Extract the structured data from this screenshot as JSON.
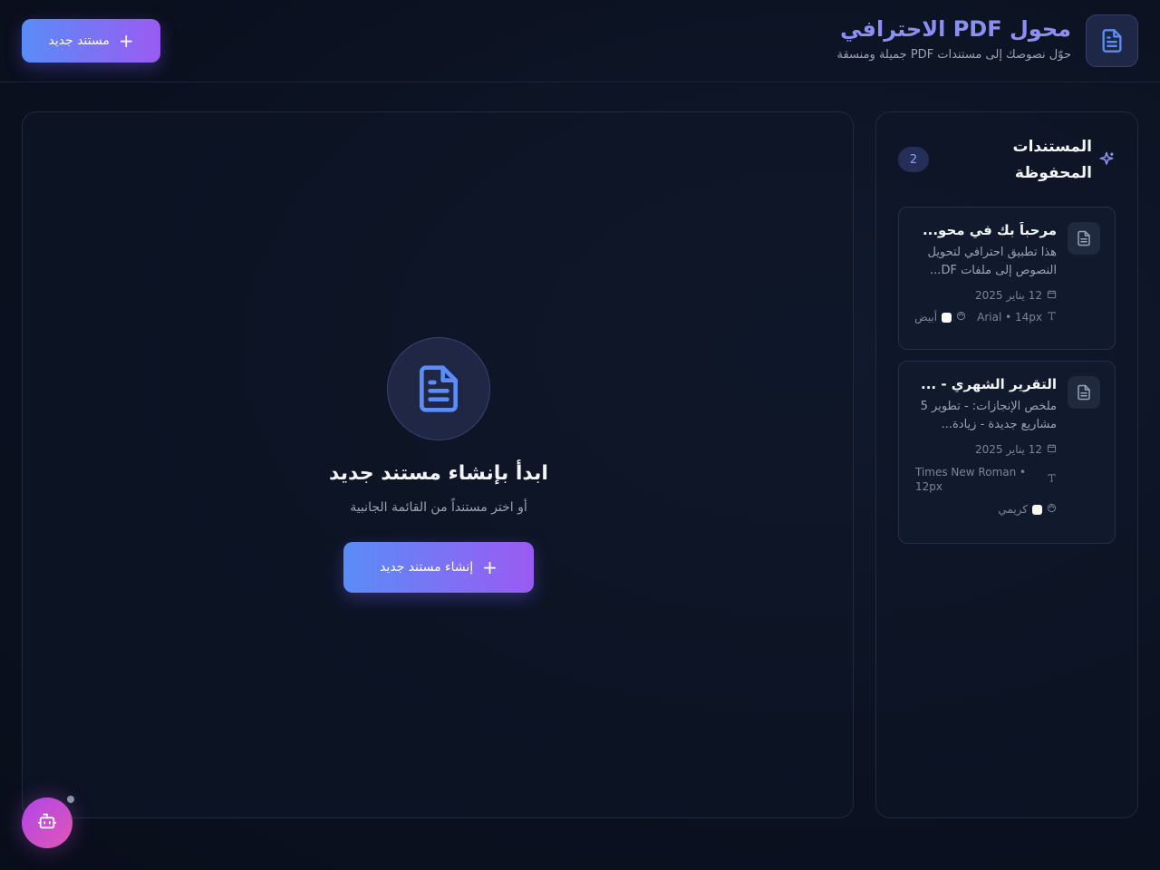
{
  "header": {
    "title": "محول PDF الاحترافي",
    "subtitle": "حوّل نصوصك إلى مستندات PDF جميلة ومنسقة",
    "new_doc_label": "مستند جديد",
    "icon": "file-text-icon"
  },
  "main": {
    "empty_title": "ابدأ بإنشاء مستند جديد",
    "empty_subtitle": "أو اختر مستنداً من القائمة الجانبية",
    "create_label": "إنشاء مستند جديد"
  },
  "sidebar": {
    "title": "المستندات المحفوظة",
    "count": "2",
    "documents": [
      {
        "title": "مرحباً بك في محو...",
        "excerpt": "هذا تطبيق احترافي لتحويل النصوص إلى ملفات DF...",
        "date": "12 يناير 2025",
        "font": "Arial • 14px",
        "color_name": "أبيض",
        "swatch": "#ffffff"
      },
      {
        "title": "التقرير الشهري - ...",
        "excerpt": "ملخص الإنجازات: - تطوير 5 مشاريع جديدة - زيادة...",
        "date": "12 يناير 2025",
        "font": "Times New Roman • 12px",
        "color_name": "كريمي",
        "swatch": "#fdf8ec"
      }
    ]
  },
  "colors": {
    "accent_start": "#5a8cf7",
    "accent_end": "#9a5bf2",
    "title": "#8b8ff5",
    "bot_start": "#b046e8",
    "bot_end": "#e056b4"
  }
}
